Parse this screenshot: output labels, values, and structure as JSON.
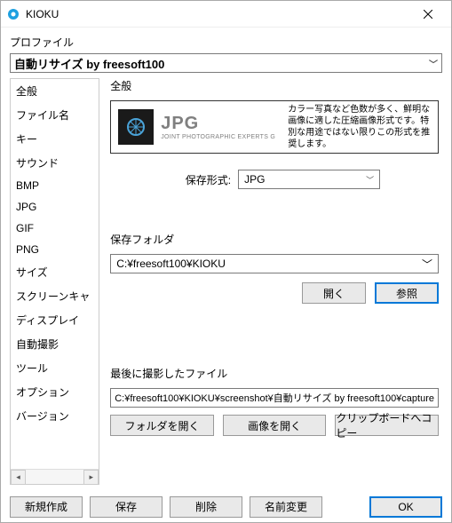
{
  "window": {
    "title": "KIOKU"
  },
  "profile": {
    "label": "プロファイル",
    "selected": "自動リサイズ by freesoft100"
  },
  "sidebar": {
    "items": [
      {
        "label": "全般"
      },
      {
        "label": "ファイル名"
      },
      {
        "label": "キー"
      },
      {
        "label": "サウンド"
      },
      {
        "label": "BMP"
      },
      {
        "label": "JPG"
      },
      {
        "label": "GIF"
      },
      {
        "label": "PNG"
      },
      {
        "label": "サイズ"
      },
      {
        "label": "スクリーンキャ"
      },
      {
        "label": "ディスプレイ"
      },
      {
        "label": "自動撮影"
      },
      {
        "label": "ツール"
      },
      {
        "label": "オプション"
      },
      {
        "label": "バージョン"
      }
    ]
  },
  "main": {
    "section_title": "全般",
    "format_card": {
      "name": "JPG",
      "subtitle": "JOINT PHOTOGRAPHIC EXPERTS G",
      "description": "カラー写真など色数が多く、鮮明な画像に適した圧縮画像形式です。特別な用途ではない限りこの形式を推奨します。"
    },
    "save_format": {
      "label": "保存形式:",
      "value": "JPG"
    },
    "save_folder": {
      "label": "保存フォルダ",
      "value": "C:¥freesoft100¥KIOKU",
      "open_btn": "開く",
      "browse_btn": "参照"
    },
    "last_file": {
      "label": "最後に撮影したファイル",
      "value": "C:¥freesoft100¥KIOKU¥screenshot¥自動リサイズ by freesoft100¥capture",
      "open_folder_btn": "フォルダを開く",
      "open_image_btn": "画像を開く",
      "copy_clipboard_btn": "クリップボードへコピー"
    }
  },
  "bottom": {
    "new_btn": "新規作成",
    "save_btn": "保存",
    "delete_btn": "削除",
    "rename_btn": "名前変更",
    "ok_btn": "OK"
  }
}
